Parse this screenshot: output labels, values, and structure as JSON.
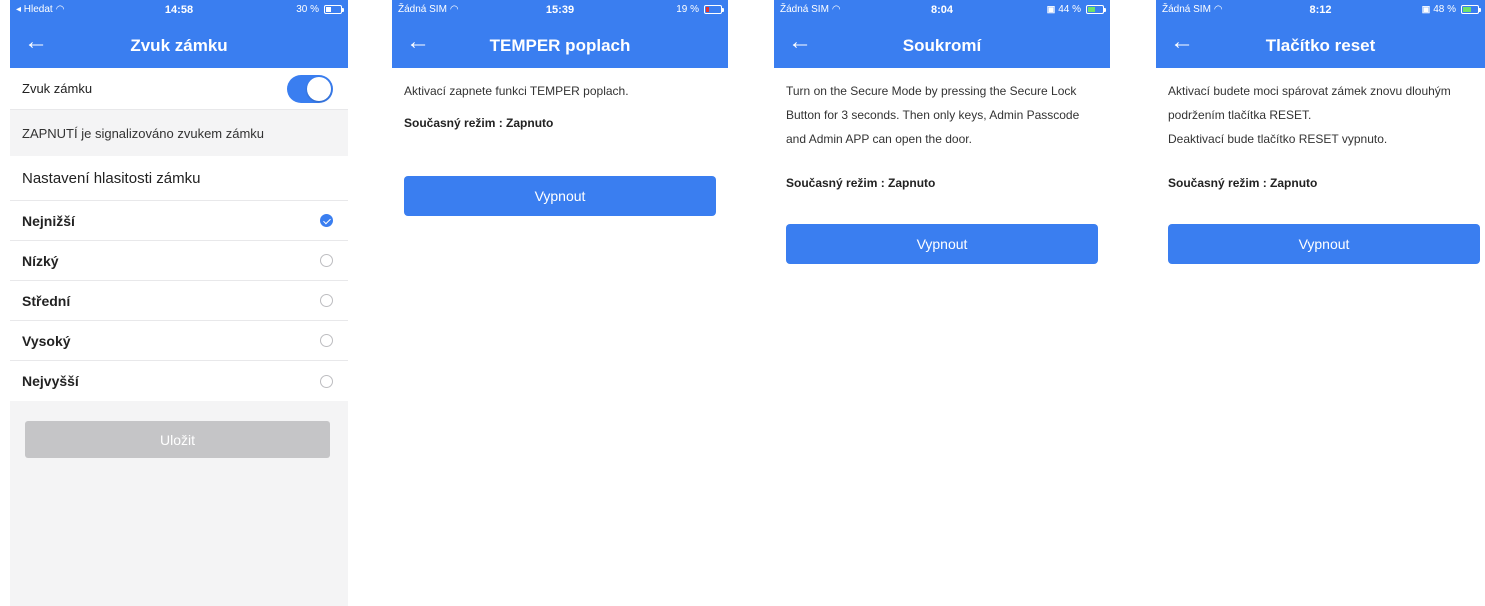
{
  "colors": {
    "accent": "#3a7ef0",
    "disabled": "#c5c5c7",
    "background": "#f4f4f5"
  },
  "screens": [
    {
      "status": {
        "left": "◂ Hledat",
        "time": "14:58",
        "battery": "30 %"
      },
      "title": "Zvuk zámku",
      "back_icon": "arrow-left-icon",
      "toggle_label": "Zvuk zámku",
      "toggle_on": true,
      "note": "ZAPNUTÍ je signalizováno zvukem zámku",
      "section_title": "Nastavení hlasitosti zámku",
      "options": [
        "Nejnižší",
        "Nízký",
        "Střední",
        "Vysoký",
        "Nejvyšší"
      ],
      "selected_index": 0,
      "save_label": "Uložit"
    },
    {
      "status": {
        "left": "Žádná SIM",
        "time": "15:39",
        "battery": "19 %"
      },
      "title": "TEMPER poplach",
      "body": "Aktivací zapnete funkci TEMPER poplach.",
      "mode": "Současný režim : Zapnuto",
      "button": "Vypnout"
    },
    {
      "status": {
        "left": "Žádná SIM",
        "time": "8:04",
        "battery": "44 %"
      },
      "title": "Soukromí",
      "body": "Turn on the Secure Mode by pressing the Secure Lock Button for 3 seconds. Then only keys, Admin Passcode and Admin APP can open the door.",
      "mode": "Současný režim : Zapnuto",
      "button": "Vypnout"
    },
    {
      "status": {
        "left": "Žádná SIM",
        "time": "8:12",
        "battery": "48 %"
      },
      "title": "Tlačítko reset",
      "body_lines": [
        "Aktivací budete moci spárovat zámek znovu dlouhým podržením tlačítka RESET.",
        "Deaktivací bude tlačítko RESET vypnuto."
      ],
      "mode": "Současný režim : Zapnuto",
      "button": "Vypnout"
    }
  ]
}
